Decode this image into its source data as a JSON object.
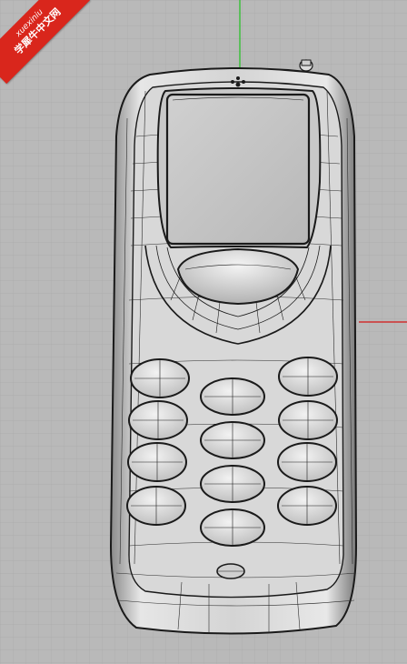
{
  "viewport": {
    "background_color": "#b9b9b9",
    "grid_color": "#a8a8a8",
    "axis_y_color": "#3dbf3d",
    "axis_x_color": "#d03030"
  },
  "model": {
    "subject": "mobile-phone-model",
    "keypad_keys": 14,
    "body_color": "#d2d2d2",
    "wire_color": "#1a1a1a"
  },
  "watermark": {
    "line1": "xuexiniu",
    "line2": "学犀牛中文网",
    "color": "#d9261c"
  }
}
